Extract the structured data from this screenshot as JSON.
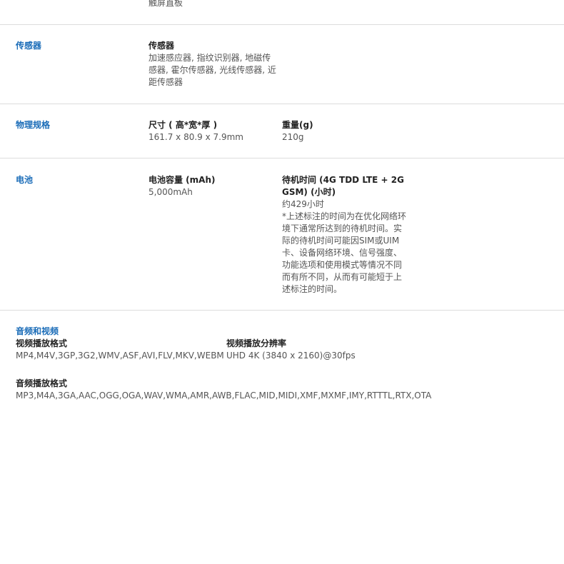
{
  "top_fragment": "触屏直板",
  "sensors": {
    "title": "传感器",
    "label": "传感器",
    "value": "加速感应器, 指纹识别器, 地磁传感器, 霍尔传感器, 光线传感器, 近距传感器"
  },
  "physical": {
    "title": "物理规格",
    "size_label": "尺寸 ( 高*宽*厚 )",
    "size_value": "161.7 x 80.9 x 7.9mm",
    "weight_label": "重量(g)",
    "weight_value": "210g"
  },
  "battery": {
    "title": "电池",
    "capacity_label": "电池容量 (mAh)",
    "capacity_value": "5,000mAh",
    "standby_label": "待机时间 (4G TDD LTE + 2G GSM) (小时)",
    "standby_value": "约429小时",
    "standby_note": "*上述标注的时间为在优化网络环境下通常所达到的待机时间。实际的待机时间可能因SIM或UIM卡、设备网络环境、信号强度、功能选项和使用模式等情况不同而有所不同，从而有可能短于上述标注的时间。"
  },
  "audio_video": {
    "title": "音频和视频",
    "video_format_label": "视频播放格式",
    "video_format_value": "MP4,M4V,3GP,3G2,WMV,ASF,AVI,FLV,MKV,WEBM",
    "video_res_label": "视频播放分辨率",
    "video_res_value": "UHD 4K (3840 x 2160)@30fps",
    "audio_format_label": "音频播放格式",
    "audio_format_value": "MP3,M4A,3GA,AAC,OGG,OGA,WAV,WMA,AMR,AWB,FLAC,MID,MIDI,XMF,MXMF,IMY,RTTTL,RTX,OTA"
  },
  "colors": {
    "section_title": "#1a6cb8",
    "divider": "#dcdcdc",
    "label": "#222222",
    "value": "#555555"
  }
}
